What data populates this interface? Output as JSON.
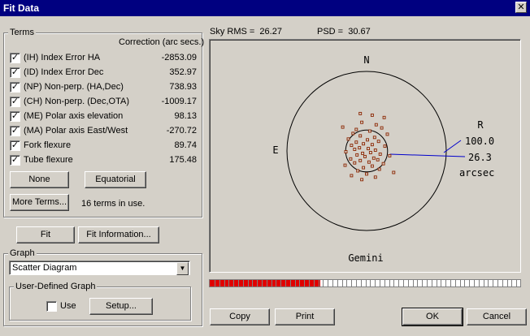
{
  "window": {
    "title": "Fit Data",
    "close_glyph": "✕"
  },
  "terms": {
    "legend": "Terms",
    "column_header": "Correction (arc secs.)",
    "items": [
      {
        "label": "(IH) Index Error HA",
        "value": "-2853.09",
        "checked": true
      },
      {
        "label": "(ID) Index Error Dec",
        "value": "352.97",
        "checked": true
      },
      {
        "label": "(NP) Non-perp. (HA,Dec)",
        "value": "738.93",
        "checked": true
      },
      {
        "label": "(CH) Non-perp. (Dec,OTA)",
        "value": "-1009.17",
        "checked": true
      },
      {
        "label": "(ME) Polar axis elevation",
        "value": "98.13",
        "checked": true
      },
      {
        "label": "(MA) Polar axis East/West",
        "value": "-270.72",
        "checked": true
      },
      {
        "label": "Fork flexure",
        "value": "89.74",
        "checked": true
      },
      {
        "label": "Tube flexure",
        "value": "175.48",
        "checked": true
      }
    ],
    "none_button": "None",
    "equatorial_button": "Equatorial",
    "more_terms_button": "More Terms...",
    "terms_in_use": "16 terms in use."
  },
  "actions": {
    "fit_button": "Fit",
    "fit_info_button": "Fit Information..."
  },
  "graph": {
    "legend": "Graph",
    "selected": "Scatter Diagram",
    "user_defined_legend": "User-Defined Graph",
    "use_label": "Use",
    "use_checked": false,
    "setup_button": "Setup..."
  },
  "stats": {
    "sky_rms": "Sky RMS =  26.27",
    "psd": "PSD =  30.67"
  },
  "plot": {
    "north": "N",
    "east": "E",
    "r_label": "R",
    "outer_radius": "100.0",
    "inner_radius": "26.3",
    "units": "arcsec",
    "mount": "Gemini",
    "outer_radius_value": 100.0,
    "inner_radius_value": 26.3,
    "points": [
      [
        -8,
        -47
      ],
      [
        7,
        -45
      ],
      [
        22,
        -42
      ],
      [
        -6,
        -36
      ],
      [
        12,
        -33
      ],
      [
        -30,
        -30
      ],
      [
        19,
        -29
      ],
      [
        -13,
        -27
      ],
      [
        4,
        -25
      ],
      [
        -17,
        -22
      ],
      [
        26,
        -21
      ],
      [
        -8,
        -19
      ],
      [
        10,
        -17
      ],
      [
        -23,
        -15
      ],
      [
        1,
        -14
      ],
      [
        15,
        -12
      ],
      [
        -13,
        -11
      ],
      [
        -4,
        -9
      ],
      [
        7,
        -8
      ],
      [
        -19,
        -7
      ],
      [
        23,
        -6
      ],
      [
        -9,
        -4
      ],
      [
        2,
        -3
      ],
      [
        -15,
        -2
      ],
      [
        11,
        -1
      ],
      [
        -26,
        1
      ],
      [
        5,
        2
      ],
      [
        -5,
        3
      ],
      [
        17,
        4
      ],
      [
        -12,
        5
      ],
      [
        29,
        6
      ],
      [
        -2,
        7
      ],
      [
        9,
        9
      ],
      [
        -20,
        10
      ],
      [
        14,
        11
      ],
      [
        -8,
        12
      ],
      [
        3,
        14
      ],
      [
        -15,
        15
      ],
      [
        21,
        16
      ],
      [
        -27,
        18
      ],
      [
        7,
        19
      ],
      [
        -4,
        21
      ],
      [
        16,
        23
      ],
      [
        -11,
        25
      ],
      [
        34,
        27
      ],
      [
        0,
        29
      ],
      [
        -19,
        31
      ],
      [
        11,
        33
      ],
      [
        -6,
        36
      ]
    ]
  },
  "progress": {
    "fraction": 0.355,
    "fill_color": "#e00000"
  },
  "footer": {
    "copy_button": "Copy",
    "print_button": "Print",
    "ok_button": "OK",
    "cancel_button": "Cancel"
  }
}
